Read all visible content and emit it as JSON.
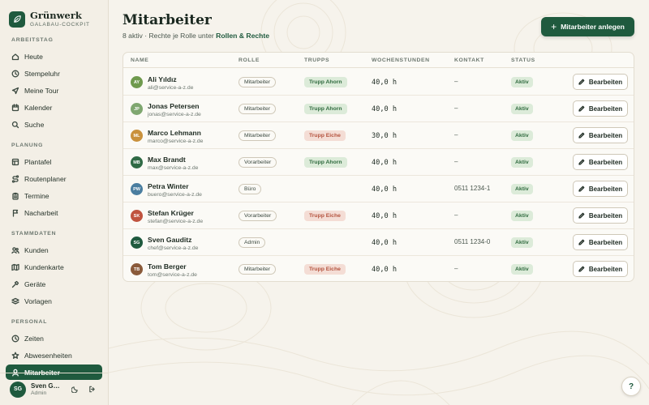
{
  "brand": {
    "name": "Grünwerk",
    "subtitle": "GALABAU-COCKPIT"
  },
  "sidebar": {
    "sections": [
      {
        "label": "ARBEITSTAG",
        "items": [
          {
            "label": "Heute",
            "icon": "home-icon"
          },
          {
            "label": "Stempeluhr",
            "icon": "clock-icon"
          },
          {
            "label": "Meine Tour",
            "icon": "navigation-icon"
          },
          {
            "label": "Kalender",
            "icon": "calendar-icon"
          },
          {
            "label": "Suche",
            "icon": "search-icon"
          }
        ]
      },
      {
        "label": "PLANUNG",
        "items": [
          {
            "label": "Plantafel",
            "icon": "grid-icon"
          },
          {
            "label": "Routenplaner",
            "icon": "route-icon"
          },
          {
            "label": "Termine",
            "icon": "clipboard-icon"
          },
          {
            "label": "Nacharbeit",
            "icon": "flag-icon"
          }
        ]
      },
      {
        "label": "STAMMDATEN",
        "items": [
          {
            "label": "Kunden",
            "icon": "users-icon"
          },
          {
            "label": "Kundenkarte",
            "icon": "map-icon"
          },
          {
            "label": "Geräte",
            "icon": "hammer-icon"
          },
          {
            "label": "Vorlagen",
            "icon": "layers-icon"
          }
        ]
      },
      {
        "label": "PERSONAL",
        "items": [
          {
            "label": "Zeiten",
            "icon": "clock-icon"
          },
          {
            "label": "Abwesenheiten",
            "icon": "star-icon"
          },
          {
            "label": "Mitarbeiter",
            "icon": "user-icon",
            "active": true
          }
        ]
      }
    ],
    "user": {
      "initials": "SG",
      "name": "Sven Gauditz",
      "role": "Admin"
    }
  },
  "header": {
    "title": "Mitarbeiter",
    "subtitle_prefix": "8 aktiv · Rechte je Rolle unter",
    "subtitle_link": "Rollen & Rechte",
    "add_button": "Mitarbeiter anlegen"
  },
  "table": {
    "columns": [
      "NAME",
      "ROLLE",
      "TRUPPS",
      "WOCHENSTUNDEN",
      "KONTAKT",
      "STATUS"
    ],
    "edit_label": "Bearbeiten",
    "rows": [
      {
        "initials": "AY",
        "avatar_color": "#6f9a4e",
        "name": "Ali Yıldız",
        "email": "ali@service-a-z.de",
        "role": "Mitarbeiter",
        "trupp": "Trupp Ahorn",
        "trupp_type": "ahorn",
        "hours": "40,0 h",
        "contact": "–",
        "status": "Aktiv"
      },
      {
        "initials": "JP",
        "avatar_color": "#7fa770",
        "name": "Jonas Petersen",
        "email": "jonas@service-a-z.de",
        "role": "Mitarbeiter",
        "trupp": "Trupp Ahorn",
        "trupp_type": "ahorn",
        "hours": "40,0 h",
        "contact": "–",
        "status": "Aktiv"
      },
      {
        "initials": "ML",
        "avatar_color": "#c9913c",
        "name": "Marco Lehmann",
        "email": "marco@service-a-z.de",
        "role": "Mitarbeiter",
        "trupp": "Trupp Eiche",
        "trupp_type": "eiche",
        "hours": "30,0 h",
        "contact": "–",
        "status": "Aktiv"
      },
      {
        "initials": "MB",
        "avatar_color": "#2f6a45",
        "name": "Max Brandt",
        "email": "max@service-a-z.de",
        "role": "Vorarbeiter",
        "trupp": "Trupp Ahorn",
        "trupp_type": "ahorn",
        "hours": "40,0 h",
        "contact": "–",
        "status": "Aktiv"
      },
      {
        "initials": "PW",
        "avatar_color": "#4a7ea0",
        "name": "Petra Winter",
        "email": "buero@service-a-z.de",
        "role": "Büro",
        "trupp": "",
        "trupp_type": "",
        "hours": "40,0 h",
        "contact": "0511 1234-1",
        "status": "Aktiv"
      },
      {
        "initials": "SK",
        "avatar_color": "#c0533f",
        "name": "Stefan Krüger",
        "email": "stefan@service-a-z.de",
        "role": "Vorarbeiter",
        "trupp": "Trupp Eiche",
        "trupp_type": "eiche",
        "hours": "40,0 h",
        "contact": "–",
        "status": "Aktiv"
      },
      {
        "initials": "SG",
        "avatar_color": "#1f5a3e",
        "name": "Sven Gauditz",
        "email": "chef@service-a-z.de",
        "role": "Admin",
        "trupp": "",
        "trupp_type": "",
        "hours": "40,0 h",
        "contact": "0511 1234-0",
        "status": "Aktiv"
      },
      {
        "initials": "TB",
        "avatar_color": "#8a5a3a",
        "name": "Tom Berger",
        "email": "tom@service-a-z.de",
        "role": "Mitarbeiter",
        "trupp": "Trupp Eiche",
        "trupp_type": "eiche",
        "hours": "40,0 h",
        "contact": "–",
        "status": "Aktiv"
      }
    ]
  },
  "help": {
    "label": "?"
  },
  "colors": {
    "primary": "#1f5a3e",
    "background": "#f6f3ec",
    "ahorn": "#2f6a3e",
    "eiche": "#b4533e"
  }
}
